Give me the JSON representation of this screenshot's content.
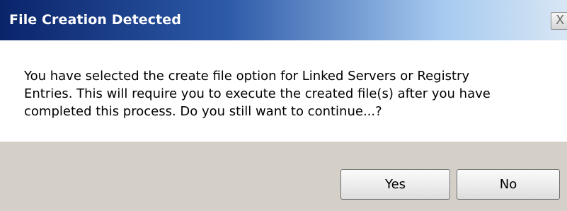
{
  "dialog": {
    "title": "File Creation Detected",
    "close_label": "X",
    "message_lines": [
      "You have selected the create file option for Linked Servers or Registry",
      "Entries.  This will require you to execute the created file(s) after you have",
      "completed this process.  Do you still want to continue...?"
    ],
    "buttons": {
      "yes": "Yes",
      "no": "No"
    }
  },
  "colors": {
    "title_bar_start": "#0a246a",
    "title_bar_end": "#d8e6f4",
    "footer_background": "#d4d0c8"
  }
}
